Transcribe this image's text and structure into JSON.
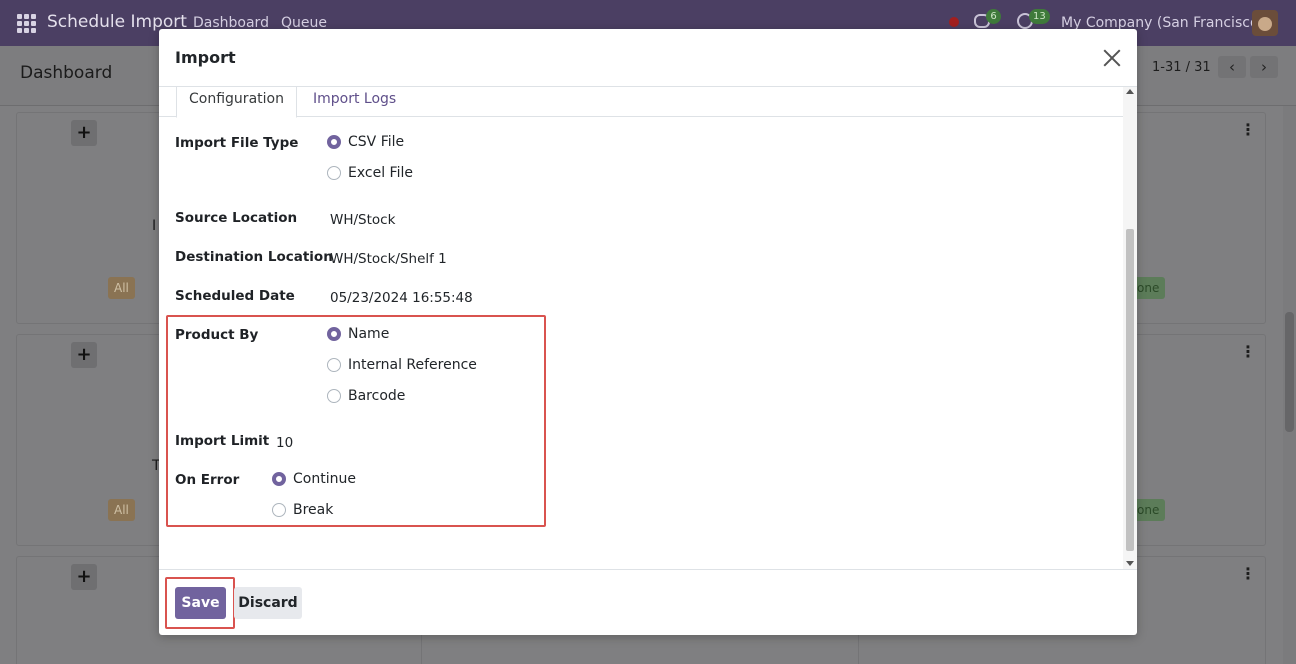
{
  "navbar": {
    "app_name": "Schedule Import",
    "menu": [
      "Dashboard",
      "Queue"
    ],
    "messages_count": "6",
    "activities_count": "13",
    "company": "My Company (San Francisco)"
  },
  "control_panel": {
    "title": "Dashboard",
    "pager": "1-31 / 31"
  },
  "background_cards": {
    "tag_all": "All",
    "tag_done": "one",
    "fragment_1": "I",
    "fragment_2": "T"
  },
  "modal": {
    "title": "Import",
    "tabs": [
      "Configuration",
      "Import Logs"
    ],
    "import_file_type": {
      "label": "Import File Type",
      "options": [
        "CSV File",
        "Excel File"
      ],
      "selected": "CSV File"
    },
    "source_location": {
      "label": "Source Location",
      "value": "WH/Stock"
    },
    "destination_location": {
      "label": "Destination Location",
      "value": "WH/Stock/Shelf 1"
    },
    "scheduled_date": {
      "label": "Scheduled Date",
      "value": "05/23/2024 16:55:48"
    },
    "product_by": {
      "label": "Product By",
      "options": [
        "Name",
        "Internal Reference",
        "Barcode"
      ],
      "selected": "Name"
    },
    "import_limit": {
      "label": "Import Limit",
      "value": "10"
    },
    "on_error": {
      "label": "On Error",
      "options": [
        "Continue",
        "Break"
      ],
      "selected": "Continue"
    },
    "footer": {
      "save_label": "Save",
      "discard_label": "Discard"
    }
  },
  "colors": {
    "navbar": "#4b3f63",
    "primary": "#71639e",
    "highlight": "#d9534f"
  }
}
